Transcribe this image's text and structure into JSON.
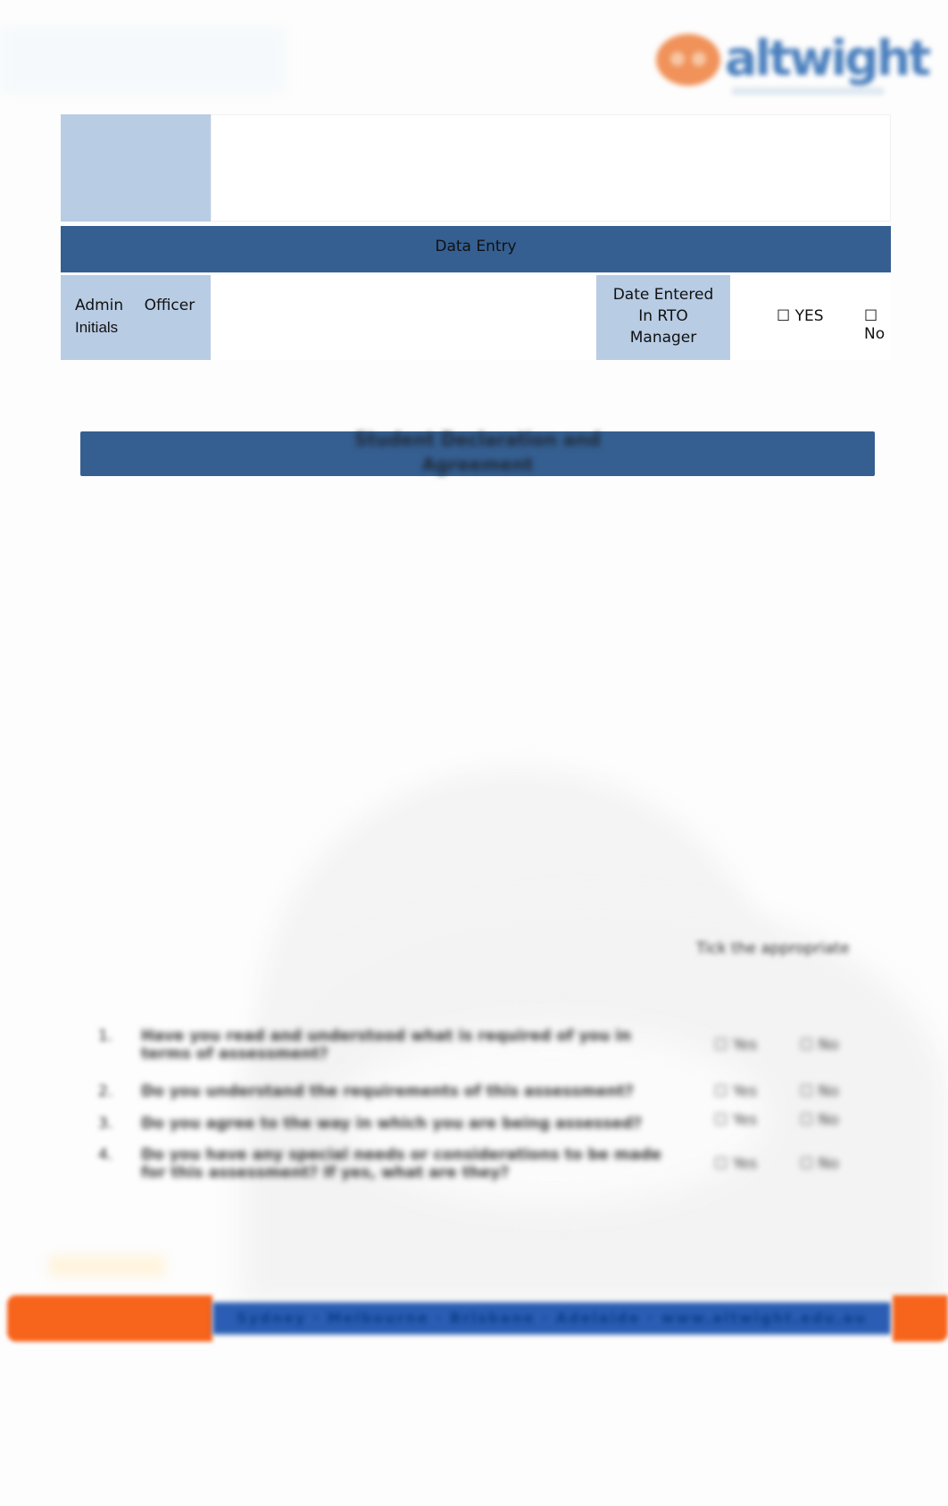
{
  "header": {
    "logo_text": "altwight",
    "colors": {
      "logo_orange": "#f0925a",
      "logo_blue": "#4a7fbd"
    }
  },
  "data_entry_table": {
    "title": "Data Entry",
    "admin_label_line1": "Admin Officer",
    "admin_label_line2": "Initials",
    "date_label_line1": "Date Entered",
    "date_label_line2": "In RTO",
    "date_label_line3": "Manager",
    "option_yes": "☐ YES",
    "option_no": "☐ No",
    "colors": {
      "label_fill": "#b8cce4",
      "header_fill": "#355f91"
    }
  },
  "section": {
    "title_line1": "Student Declaration and",
    "title_line2": "Agreement"
  },
  "questions": {
    "header": "Tick the appropriate",
    "items": [
      {
        "num": "1.",
        "text": "Have you read and understood what is required of you in terms of assessment?",
        "yes": "☐ Yes",
        "no": "☐ No"
      },
      {
        "num": "2.",
        "text": "Do you understand the requirements of this assessment?",
        "yes": "☐ Yes",
        "no": "☐ No"
      },
      {
        "num": "3.",
        "text": "Do you agree to the way in which you are being assessed?",
        "yes": "☐ Yes",
        "no": "☐ No"
      },
      {
        "num": "4.",
        "text": "Do you have any special needs or considerations to be made for this assessment? If yes, what are they?",
        "yes": "☐ Yes",
        "no": "☐ No"
      }
    ]
  },
  "footer": {
    "bar_text": "Sydney · Melbourne · Brisbane · Adelaide · www.altwight.edu.au",
    "colors": {
      "orange": "#f7641c",
      "blue": "#2a5db3"
    }
  }
}
